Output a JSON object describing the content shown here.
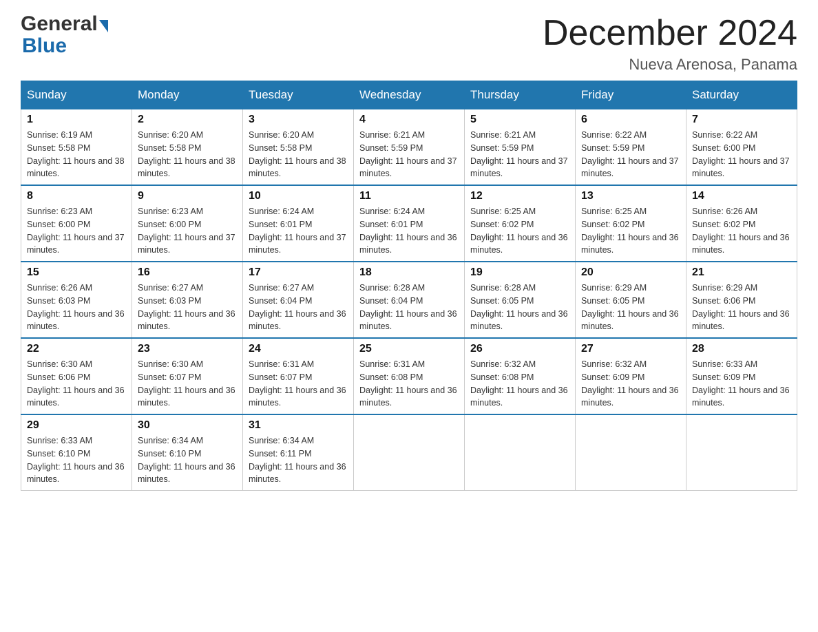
{
  "header": {
    "logo_general": "General",
    "logo_blue": "Blue",
    "month_title": "December 2024",
    "location": "Nueva Arenosa, Panama"
  },
  "days_of_week": [
    "Sunday",
    "Monday",
    "Tuesday",
    "Wednesday",
    "Thursday",
    "Friday",
    "Saturday"
  ],
  "weeks": [
    [
      {
        "day": "1",
        "sunrise": "6:19 AM",
        "sunset": "5:58 PM",
        "daylight": "11 hours and 38 minutes."
      },
      {
        "day": "2",
        "sunrise": "6:20 AM",
        "sunset": "5:58 PM",
        "daylight": "11 hours and 38 minutes."
      },
      {
        "day": "3",
        "sunrise": "6:20 AM",
        "sunset": "5:58 PM",
        "daylight": "11 hours and 38 minutes."
      },
      {
        "day": "4",
        "sunrise": "6:21 AM",
        "sunset": "5:59 PM",
        "daylight": "11 hours and 37 minutes."
      },
      {
        "day": "5",
        "sunrise": "6:21 AM",
        "sunset": "5:59 PM",
        "daylight": "11 hours and 37 minutes."
      },
      {
        "day": "6",
        "sunrise": "6:22 AM",
        "sunset": "5:59 PM",
        "daylight": "11 hours and 37 minutes."
      },
      {
        "day": "7",
        "sunrise": "6:22 AM",
        "sunset": "6:00 PM",
        "daylight": "11 hours and 37 minutes."
      }
    ],
    [
      {
        "day": "8",
        "sunrise": "6:23 AM",
        "sunset": "6:00 PM",
        "daylight": "11 hours and 37 minutes."
      },
      {
        "day": "9",
        "sunrise": "6:23 AM",
        "sunset": "6:00 PM",
        "daylight": "11 hours and 37 minutes."
      },
      {
        "day": "10",
        "sunrise": "6:24 AM",
        "sunset": "6:01 PM",
        "daylight": "11 hours and 37 minutes."
      },
      {
        "day": "11",
        "sunrise": "6:24 AM",
        "sunset": "6:01 PM",
        "daylight": "11 hours and 36 minutes."
      },
      {
        "day": "12",
        "sunrise": "6:25 AM",
        "sunset": "6:02 PM",
        "daylight": "11 hours and 36 minutes."
      },
      {
        "day": "13",
        "sunrise": "6:25 AM",
        "sunset": "6:02 PM",
        "daylight": "11 hours and 36 minutes."
      },
      {
        "day": "14",
        "sunrise": "6:26 AM",
        "sunset": "6:02 PM",
        "daylight": "11 hours and 36 minutes."
      }
    ],
    [
      {
        "day": "15",
        "sunrise": "6:26 AM",
        "sunset": "6:03 PM",
        "daylight": "11 hours and 36 minutes."
      },
      {
        "day": "16",
        "sunrise": "6:27 AM",
        "sunset": "6:03 PM",
        "daylight": "11 hours and 36 minutes."
      },
      {
        "day": "17",
        "sunrise": "6:27 AM",
        "sunset": "6:04 PM",
        "daylight": "11 hours and 36 minutes."
      },
      {
        "day": "18",
        "sunrise": "6:28 AM",
        "sunset": "6:04 PM",
        "daylight": "11 hours and 36 minutes."
      },
      {
        "day": "19",
        "sunrise": "6:28 AM",
        "sunset": "6:05 PM",
        "daylight": "11 hours and 36 minutes."
      },
      {
        "day": "20",
        "sunrise": "6:29 AM",
        "sunset": "6:05 PM",
        "daylight": "11 hours and 36 minutes."
      },
      {
        "day": "21",
        "sunrise": "6:29 AM",
        "sunset": "6:06 PM",
        "daylight": "11 hours and 36 minutes."
      }
    ],
    [
      {
        "day": "22",
        "sunrise": "6:30 AM",
        "sunset": "6:06 PM",
        "daylight": "11 hours and 36 minutes."
      },
      {
        "day": "23",
        "sunrise": "6:30 AM",
        "sunset": "6:07 PM",
        "daylight": "11 hours and 36 minutes."
      },
      {
        "day": "24",
        "sunrise": "6:31 AM",
        "sunset": "6:07 PM",
        "daylight": "11 hours and 36 minutes."
      },
      {
        "day": "25",
        "sunrise": "6:31 AM",
        "sunset": "6:08 PM",
        "daylight": "11 hours and 36 minutes."
      },
      {
        "day": "26",
        "sunrise": "6:32 AM",
        "sunset": "6:08 PM",
        "daylight": "11 hours and 36 minutes."
      },
      {
        "day": "27",
        "sunrise": "6:32 AM",
        "sunset": "6:09 PM",
        "daylight": "11 hours and 36 minutes."
      },
      {
        "day": "28",
        "sunrise": "6:33 AM",
        "sunset": "6:09 PM",
        "daylight": "11 hours and 36 minutes."
      }
    ],
    [
      {
        "day": "29",
        "sunrise": "6:33 AM",
        "sunset": "6:10 PM",
        "daylight": "11 hours and 36 minutes."
      },
      {
        "day": "30",
        "sunrise": "6:34 AM",
        "sunset": "6:10 PM",
        "daylight": "11 hours and 36 minutes."
      },
      {
        "day": "31",
        "sunrise": "6:34 AM",
        "sunset": "6:11 PM",
        "daylight": "11 hours and 36 minutes."
      },
      null,
      null,
      null,
      null
    ]
  ],
  "labels": {
    "sunrise_prefix": "Sunrise: ",
    "sunset_prefix": "Sunset: ",
    "daylight_prefix": "Daylight: "
  }
}
